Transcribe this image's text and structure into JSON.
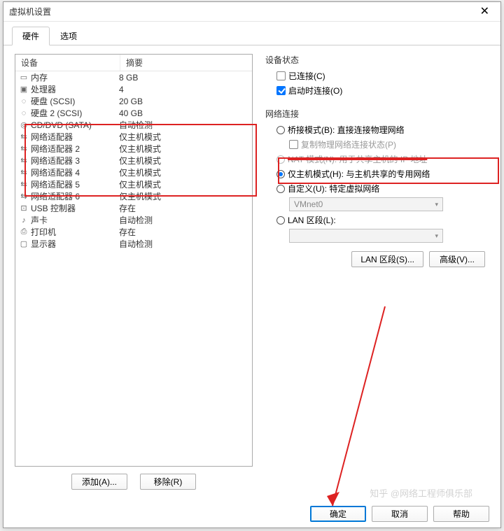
{
  "window": {
    "title": "虚拟机设置"
  },
  "tabs": {
    "hardware": "硬件",
    "options": "选项"
  },
  "list": {
    "col_device": "设备",
    "col_summary": "摘要",
    "rows": [
      {
        "icon": "▭",
        "device": "内存",
        "summary": "8 GB"
      },
      {
        "icon": "▣",
        "device": "处理器",
        "summary": "4"
      },
      {
        "icon": "◌",
        "device": "硬盘 (SCSI)",
        "summary": "20 GB"
      },
      {
        "icon": "◌",
        "device": "硬盘 2 (SCSI)",
        "summary": "40 GB"
      },
      {
        "icon": "◎",
        "device": "CD/DVD (SATA)",
        "summary": "自动检测"
      },
      {
        "icon": "⇆",
        "device": "网络适配器",
        "summary": "仅主机模式"
      },
      {
        "icon": "⇆",
        "device": "网络适配器 2",
        "summary": "仅主机模式"
      },
      {
        "icon": "⇆",
        "device": "网络适配器 3",
        "summary": "仅主机模式"
      },
      {
        "icon": "⇆",
        "device": "网络适配器 4",
        "summary": "仅主机模式"
      },
      {
        "icon": "⇆",
        "device": "网络适配器 5",
        "summary": "仅主机模式"
      },
      {
        "icon": "⇆",
        "device": "网络适配器 6",
        "summary": "仅主机模式"
      },
      {
        "icon": "⊡",
        "device": "USB 控制器",
        "summary": "存在"
      },
      {
        "icon": "♪",
        "device": "声卡",
        "summary": "自动检测"
      },
      {
        "icon": "⎙",
        "device": "打印机",
        "summary": "存在"
      },
      {
        "icon": "▢",
        "device": "显示器",
        "summary": "自动检测"
      }
    ]
  },
  "left_buttons": {
    "add": "添加(A)...",
    "remove": "移除(R)"
  },
  "status": {
    "title": "设备状态",
    "connected": "已连接(C)",
    "connect_at_poweron": "启动时连接(O)"
  },
  "network": {
    "title": "网络连接",
    "bridged": "桥接模式(B): 直接连接物理网络",
    "replicate": "复制物理网络连接状态(P)",
    "nat": "NAT 模式(N): 用于共享主机的 IP 地址",
    "hostonly": "仅主机模式(H): 与主机共享的专用网络",
    "custom": "自定义(U): 特定虚拟网络",
    "vmnet_value": "VMnet0",
    "lan_segment": "LAN 区段(L):",
    "lan_segments_btn": "LAN 区段(S)...",
    "advanced_btn": "高级(V)..."
  },
  "footer": {
    "ok": "确定",
    "cancel": "取消",
    "help": "帮助"
  },
  "watermark": "知乎 @网络工程师俱乐部"
}
